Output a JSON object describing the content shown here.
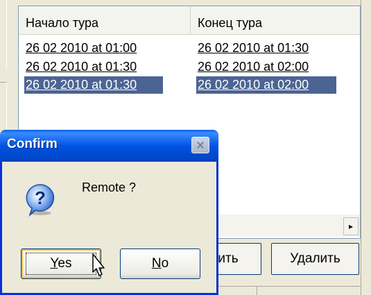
{
  "listview": {
    "columns": [
      "Начало тура",
      "Конец тура"
    ],
    "rows": [
      {
        "start": "26 02 2010 at 01:00",
        "end": "26 02 2010 at 01:30",
        "selected": false
      },
      {
        "start": "26 02 2010 at 01:30",
        "end": "26 02 2010 at 02:00",
        "selected": false
      },
      {
        "start": "26 02 2010 at 01:30",
        "end": "26 02 2010 at 02:00",
        "selected": true
      }
    ]
  },
  "scrollbar": {
    "right_arrow": "▸"
  },
  "background_buttons": {
    "edit_partial": "ить",
    "delete": "Удалить"
  },
  "dialog": {
    "title": "Confirm",
    "message": "Remote ?",
    "icon": "question-icon",
    "yes_first": "Y",
    "yes_rest": "es",
    "no_first": "N",
    "no_rest": "o"
  },
  "colors": {
    "selection": "#4b6493",
    "titlebar": "#0054e3",
    "face": "#ece9d8"
  }
}
